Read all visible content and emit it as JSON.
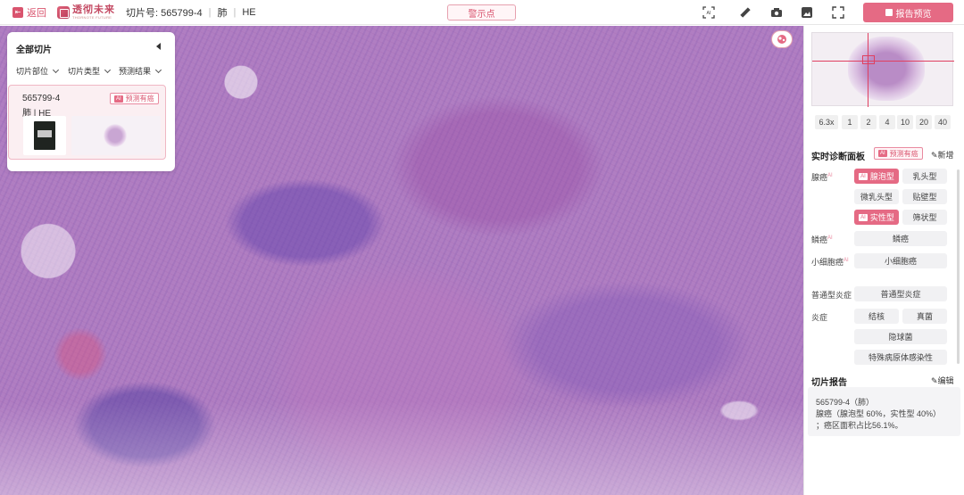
{
  "header": {
    "back_label": "返回",
    "logo_text": "透彻未来",
    "logo_sub": "THORNOTE FUTURE",
    "slide_no_label": "切片号: 565799-4",
    "organ": "肺",
    "stain": "HE",
    "warn_button": "警示点",
    "report_button": "报告预览",
    "tools": [
      "screenshot-icon",
      "ruler-icon",
      "camera-icon",
      "image-icon",
      "fullscreen-icon"
    ]
  },
  "slide_panel": {
    "title": "全部切片",
    "filters": [
      "切片部位",
      "切片类型",
      "预测结果"
    ],
    "card": {
      "id": "565799-4",
      "subtitle": "肺 | HE",
      "tag": "预测有癌",
      "ai": "AI"
    }
  },
  "magnification": {
    "current": "6.3x",
    "levels": [
      "1",
      "2",
      "4",
      "10",
      "20",
      "40"
    ]
  },
  "diagnosis": {
    "title": "实时诊断面板",
    "tag": "预测有癌",
    "add": "新增",
    "groups": [
      {
        "label": "腺癌",
        "options": [
          "腺泡型",
          "乳头型",
          "微乳头型",
          "贴壁型",
          "实性型",
          "筛状型"
        ],
        "selected": [
          "腺泡型",
          "实性型"
        ]
      },
      {
        "label": "鳞癌",
        "options": [
          "鳞癌"
        ]
      },
      {
        "label": "小细胞癌",
        "options": [
          "小细胞癌"
        ]
      },
      {
        "label": "普通型炎症",
        "options": [
          "普通型炎症"
        ]
      },
      {
        "label": "炎症",
        "options": [
          "结核",
          "真菌",
          "隐球菌",
          "特殊病原体感染性"
        ]
      }
    ]
  },
  "report": {
    "title": "切片报告",
    "edit": "编辑",
    "lines": [
      "565799-4（肺）",
      "腺癌（腺泡型 60%，实性型 40%）",
      "；癌区面积占比56.1%。"
    ]
  },
  "colors": {
    "accent": "#e56a84",
    "accent_text": "#d9546e"
  }
}
